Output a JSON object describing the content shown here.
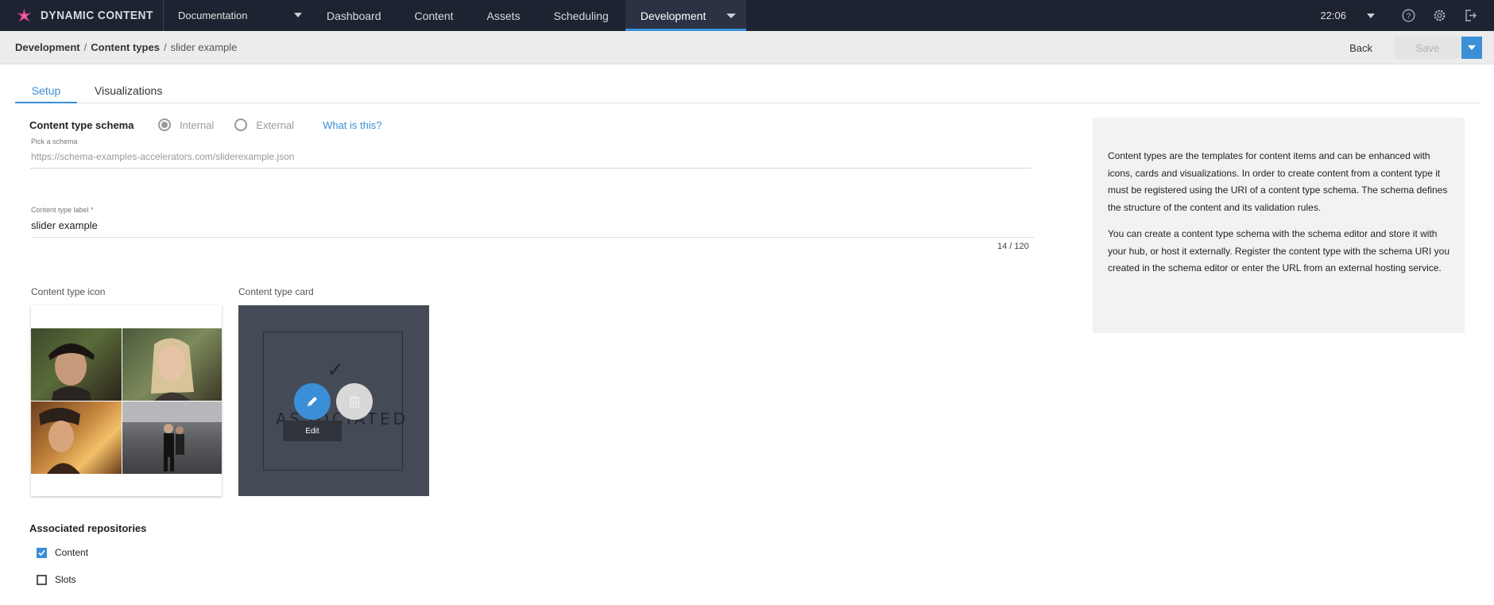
{
  "brand": {
    "name": "DYNAMIC CONTENT"
  },
  "hub": {
    "selected": "Documentation"
  },
  "nav": {
    "items": [
      "Dashboard",
      "Content",
      "Assets",
      "Scheduling"
    ],
    "active": "Development"
  },
  "topbar": {
    "time": "22:06"
  },
  "breadcrumb": {
    "items": [
      "Development",
      "Content types"
    ],
    "current": "slider example"
  },
  "actions": {
    "back": "Back",
    "save": "Save"
  },
  "tabs": {
    "setup": "Setup",
    "visualizations": "Visualizations"
  },
  "schema": {
    "title": "Content type schema",
    "option_internal": "Internal",
    "option_external": "External",
    "selected": "Internal",
    "help_link": "What is this?",
    "pick_label": "Pick a schema",
    "uri": "https://schema-examples-accelerators.com/sliderexample.json"
  },
  "label_field": {
    "label": "Content type label *",
    "value": "slider example",
    "counter": "14 / 120"
  },
  "icon_section": {
    "label": "Content type icon"
  },
  "card_section": {
    "label": "Content type card",
    "card_text": "ASSOCIATED",
    "edit_tooltip": "Edit"
  },
  "repositories": {
    "title": "Associated repositories",
    "items": [
      {
        "label": "Content",
        "checked": true
      },
      {
        "label": "Slots",
        "checked": false
      }
    ]
  },
  "info": {
    "paragraph1": "Content types are the templates for content items and can be enhanced with icons, cards and visualizations. In order to create content from a content type it must be registered using the URI of a content type schema. The schema defines the structure of the content and its validation rules.",
    "paragraph2": "You can create a content type schema with the schema editor and store it with your hub, or host it externally. Register the content type with the schema URI you created in the schema editor or enter the URL from an external hosting service."
  },
  "colors": {
    "accent": "#3a8fd6",
    "nav_bg": "#1d2331",
    "card_bg": "#454b56"
  }
}
